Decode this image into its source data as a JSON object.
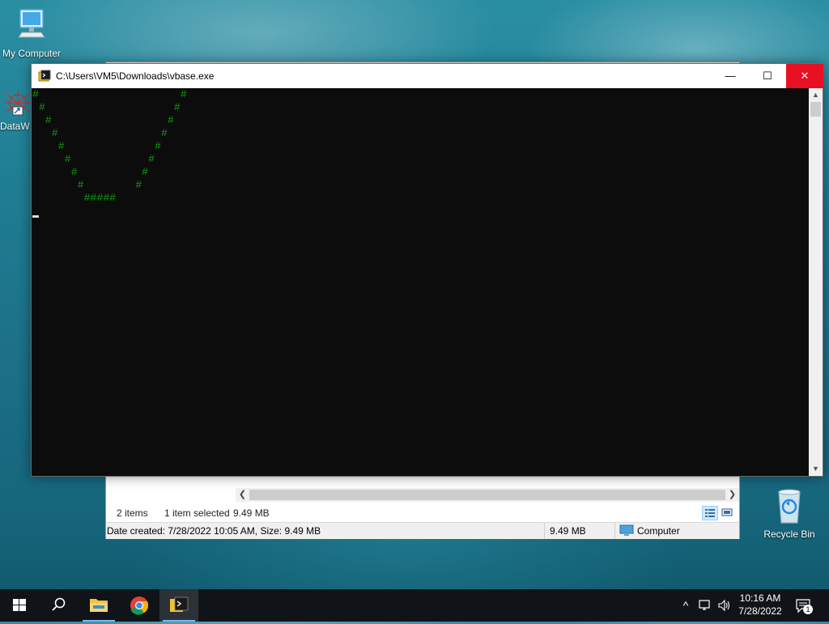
{
  "desktop": {
    "icons": [
      {
        "label": "My Computer",
        "icon": "computer-icon"
      },
      {
        "label": "DataW",
        "icon": "shortcut-icon"
      },
      {
        "label": "Recycle Bin",
        "icon": "recycle-bin-icon"
      }
    ]
  },
  "console": {
    "title": "C:\\Users\\VM5\\Downloads\\vbase.exe",
    "output": "#                      #\n #                    #\n  #                  #\n   #                #\n    #              #\n     #            #\n      #          #\n       #        #\n        #####",
    "text_color": "#13a10e",
    "background": "#0c0c0c",
    "minimize_glyph": "—",
    "maximize_glyph": "☐",
    "close_glyph": "✕"
  },
  "explorer": {
    "item_count": "2 items",
    "selection": "1 item selected",
    "selection_size": "9.49 MB",
    "details_text": "Date created: 7/28/2022 10:05 AM, Size: 9.49 MB",
    "details_size": "9.49 MB",
    "details_location": "Computer"
  },
  "taskbar": {
    "items": [
      "start-button",
      "search-button",
      "file-explorer",
      "chrome",
      "console-app"
    ],
    "time": "10:16 AM",
    "date": "7/28/2022",
    "notification_count": "1"
  }
}
